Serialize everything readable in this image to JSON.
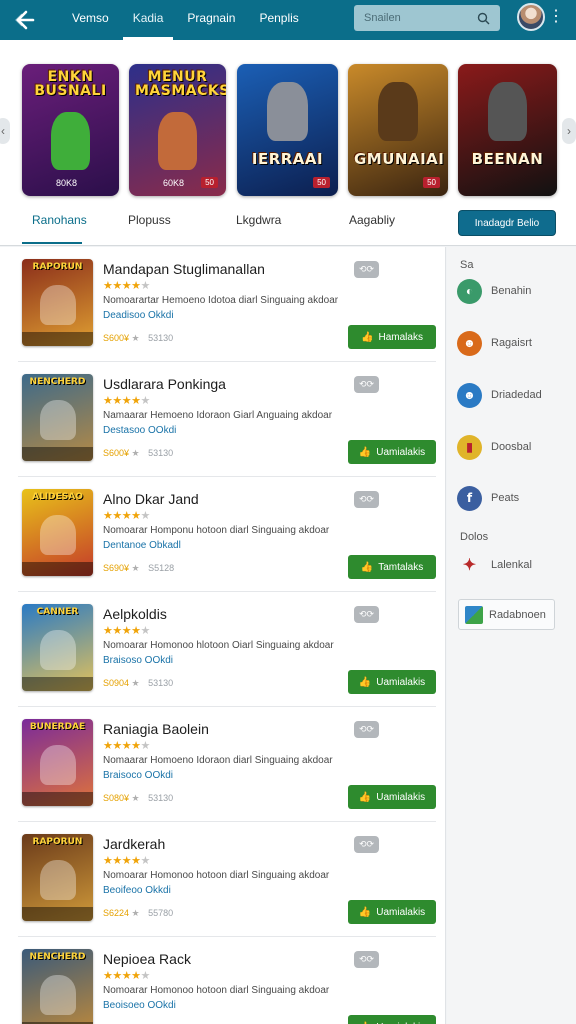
{
  "header": {
    "nav": [
      "Vemso",
      "Kadia",
      "Pragnain",
      "Penplis"
    ],
    "active_nav": 1,
    "search_placeholder": "Snailen",
    "icons": {
      "back": "back-arrow-icon",
      "search": "search-icon",
      "more": "more-vert-icon"
    }
  },
  "featured": [
    {
      "title": "ENKN BUSNALI",
      "price": "80K8",
      "badge": "",
      "colors": [
        "#6a1e7a",
        "#2b0f4a"
      ]
    },
    {
      "title": "MENUR MASMACKS",
      "price": "60K8",
      "badge": "50",
      "colors": [
        "#2d2f8a",
        "#8a2b4a"
      ]
    },
    {
      "title": "IERRAAI",
      "price": "",
      "badge": "50",
      "colors": [
        "#1b5fb5",
        "#0c1f4f"
      ]
    },
    {
      "title": "GMUNAIAI",
      "price": "",
      "badge": "50",
      "colors": [
        "#c98a2a",
        "#3a2410"
      ]
    },
    {
      "title": "BEENAN",
      "price": "",
      "badge": "",
      "colors": [
        "#8a1a1a",
        "#111111"
      ]
    }
  ],
  "tabs": {
    "items": [
      "Ranohans",
      "Plopuss",
      "Lkgdwra",
      "Aagabliy"
    ],
    "active": 0,
    "cta_label": "Inadagdr Belio"
  },
  "apps": [
    {
      "title": "Mandapan Stuglimanallan",
      "stars": 4,
      "desc": "Nomoarartar Hemoeno Idotoa diarl Singuaing akdoar",
      "dev": "Deadisoo Okkdi",
      "price": "S600¥",
      "rating": "53130",
      "install": "Hamalaks",
      "thumb_title": "RAPORUN",
      "colors": [
        "#8a2d1a",
        "#e0a032"
      ]
    },
    {
      "title": "Usdlarara Ponkinga",
      "stars": 4,
      "desc": "Namaarar Hemoeno Idoraon Giarl Anguaing akdoar",
      "dev": "Destasoo OOkdi",
      "price": "S600¥",
      "rating": "53130",
      "install": "Uamialakis",
      "thumb_title": "NENCHERD",
      "colors": [
        "#3d6a8a",
        "#b58a45"
      ]
    },
    {
      "title": "Alno Dkar Jand",
      "stars": 4,
      "desc": "Nomoarar Homponu hotoon diarl Singuaing akdoar",
      "dev": "Dentanoe Obkadl",
      "price": "S690¥",
      "rating": "S5128",
      "install": "Tamtalaks",
      "thumb_title": "ALIDESAO",
      "colors": [
        "#e8c21a",
        "#c43a2a"
      ]
    },
    {
      "title": "Aelpkoldis",
      "stars": 4,
      "desc": "Nomoarar Homonoo hlotoon Oiarl Singuaing akdoar",
      "dev": "Braisoso OOkdi",
      "price": "S0904",
      "rating": "53130",
      "install": "Uamialakis",
      "thumb_title": "CANNER",
      "colors": [
        "#2a7ac4",
        "#e4c25a"
      ]
    },
    {
      "title": "Raniagia Baolein",
      "stars": 4,
      "desc": "Nomaarar Homoeno Idoraon diarl Singuaing akdoar",
      "dev": "Braisoco OOkdi",
      "price": "S080¥",
      "rating": "53130",
      "install": "Uamialakis",
      "thumb_title": "BUNERDAE",
      "colors": [
        "#7a2a9a",
        "#e0743a"
      ]
    },
    {
      "title": "Jardkerah",
      "stars": 4,
      "desc": "Nomoarar Homonoo hotoon diarl Singuaing akdoar",
      "dev": "Beoifeoo Okkdi",
      "price": "S6224",
      "rating": "55780",
      "install": "Uamialakis",
      "thumb_title": "RAPORUN",
      "colors": [
        "#6a3a1a",
        "#d09a3a"
      ]
    },
    {
      "title": "Nepioea Rack",
      "stars": 4,
      "desc": "Nomoarar Homonoo hotoon diarl Singuaing akdoar",
      "dev": "Beoisoeo OOkdi",
      "price": "",
      "rating": "",
      "install": "Uamialakis",
      "thumb_title": "NENCHERD",
      "colors": [
        "#3a5a7a",
        "#c08a3a"
      ]
    }
  ],
  "sidebar": {
    "head1": "Sa",
    "items": [
      {
        "label": "Benahin",
        "icon": "game-character-icon",
        "color": "#3a9a6a"
      },
      {
        "label": "Ragaisrt",
        "icon": "hero-avatar-icon",
        "color": "#d96a1a"
      },
      {
        "label": "Driadedad",
        "icon": "fighter-avatar-icon",
        "color": "#2a7ac4"
      },
      {
        "label": "Doosbal",
        "icon": "jar-icon",
        "color": "#e0b42a"
      },
      {
        "label": "Peats",
        "icon": "facebook-icon",
        "color": "#3b5fa0"
      }
    ],
    "head2": "Dolos",
    "items2": [
      {
        "label": "Lalenkal",
        "icon": "ninja-icon",
        "color": "#b82a2a"
      }
    ],
    "box_label": "Radabnoen"
  }
}
